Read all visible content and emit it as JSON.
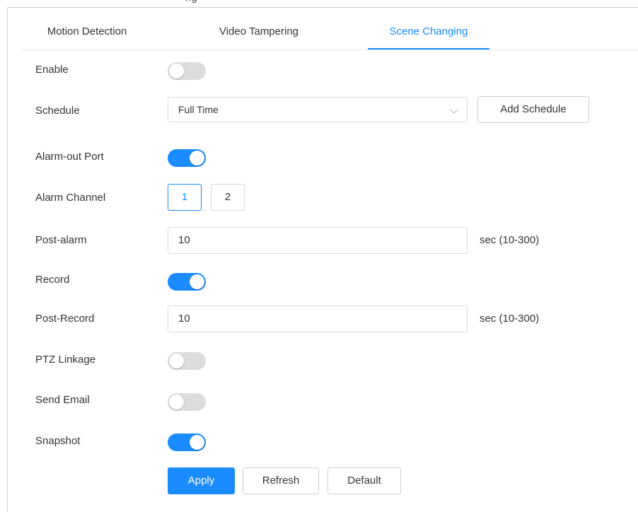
{
  "top_peek": "ng",
  "tabs": [
    {
      "label": "Motion Detection",
      "active": false
    },
    {
      "label": "Video Tampering",
      "active": false
    },
    {
      "label": "Scene Changing",
      "active": true
    }
  ],
  "form": {
    "enable": {
      "label": "Enable",
      "on": false
    },
    "schedule": {
      "label": "Schedule",
      "value": "Full Time",
      "add_button": "Add Schedule"
    },
    "alarm_out_port": {
      "label": "Alarm-out Port",
      "on": true
    },
    "alarm_channel": {
      "label": "Alarm Channel",
      "options": [
        "1",
        "2"
      ],
      "selected": "1"
    },
    "post_alarm": {
      "label": "Post-alarm",
      "value": "10",
      "unit": "sec (10-300)"
    },
    "record": {
      "label": "Record",
      "on": true
    },
    "post_record": {
      "label": "Post-Record",
      "value": "10",
      "unit": "sec (10-300)"
    },
    "ptz_linkage": {
      "label": "PTZ Linkage",
      "on": false
    },
    "send_email": {
      "label": "Send Email",
      "on": false
    },
    "snapshot": {
      "label": "Snapshot",
      "on": true
    }
  },
  "actions": {
    "apply": "Apply",
    "refresh": "Refresh",
    "default": "Default"
  },
  "colors": {
    "accent": "#1a8cff",
    "toggle_off": "#dcdcdc",
    "border": "#d9d9d9"
  },
  "icons": {
    "dropdown": "chevron-down-icon"
  }
}
